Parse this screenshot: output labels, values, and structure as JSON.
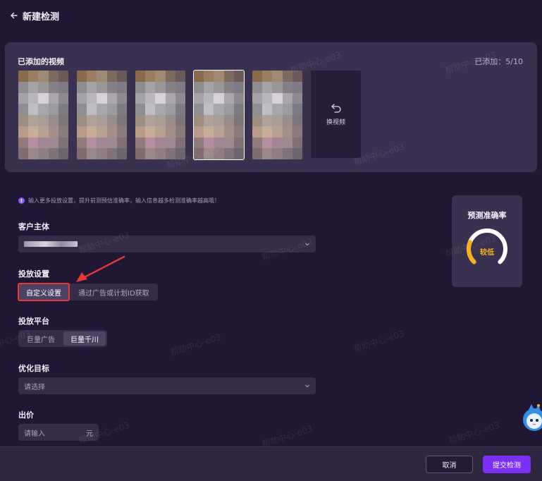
{
  "header": {
    "title": "新建检测"
  },
  "videos": {
    "title": "已添加的视频",
    "count_label": "已添加：5/10",
    "swap_label": "换视频",
    "thumbnails": [
      {
        "palette": [
          "#8a6a4e",
          "#9b7e62",
          "#a08a74",
          "#7d6a60",
          "#6a5a5a",
          "#8f8c90",
          "#a5a3a8",
          "#9a9698",
          "#857f86",
          "#7f7a86",
          "#a6a3a8",
          "#b8b6bb",
          "#d4d2d6",
          "#a9a7ab",
          "#8d8a90",
          "#8f8e94",
          "#bfbec4",
          "#a7a6ab",
          "#9d9ba0",
          "#7d7b84",
          "#9c8f82",
          "#b0a29a",
          "#a69d96",
          "#988d8a",
          "#7e7578",
          "#b89a88",
          "#c6ad98",
          "#b7a192",
          "#a28f88",
          "#8a7b7c",
          "#8f7a7c",
          "#b48da0",
          "#a38596",
          "#9c8a90",
          "#7f7076",
          "#7e6c70",
          "#9b888a",
          "#8f7f82",
          "#80727a",
          "#6e646c"
        ]
      },
      {
        "palette": [
          "#8a6a4e",
          "#9b7e62",
          "#a08a74",
          "#7d6a60",
          "#6a5a5a",
          "#8f8c90",
          "#a5a3a8",
          "#9a9698",
          "#857f86",
          "#7f7a86",
          "#a6a3a8",
          "#b8b6bb",
          "#d4d2d6",
          "#a9a7ab",
          "#8d8a90",
          "#8f8e94",
          "#bfbec4",
          "#a7a6ab",
          "#9d9ba0",
          "#7d7b84",
          "#9c8f82",
          "#b0a29a",
          "#a69d96",
          "#988d8a",
          "#7e7578",
          "#b89a88",
          "#c6ad98",
          "#b7a192",
          "#a28f88",
          "#8a7b7c",
          "#8f7a7c",
          "#b48da0",
          "#a38596",
          "#9c8a90",
          "#7f7076",
          "#7e6c70",
          "#9b888a",
          "#8f7f82",
          "#80727a",
          "#6e646c"
        ]
      },
      {
        "palette": [
          "#8a6a4e",
          "#9b7e62",
          "#a08a74",
          "#7d6a60",
          "#6a5a5a",
          "#8f8c90",
          "#a5a3a8",
          "#9a9698",
          "#857f86",
          "#7f7a86",
          "#a6a3a8",
          "#b8b6bb",
          "#d4d2d6",
          "#a9a7ab",
          "#8d8a90",
          "#8f8e94",
          "#bfbec4",
          "#a7a6ab",
          "#9d9ba0",
          "#7d7b84",
          "#9c8f82",
          "#b0a29a",
          "#a69d96",
          "#988d8a",
          "#7e7578",
          "#b89a88",
          "#c6ad98",
          "#b7a192",
          "#a28f88",
          "#8a7b7c",
          "#8f7a7c",
          "#b48da0",
          "#a38596",
          "#9c8a90",
          "#7f7076",
          "#7e6c70",
          "#9b888a",
          "#8f7f82",
          "#80727a",
          "#6e646c"
        ]
      },
      {
        "palette": [
          "#8a6a4e",
          "#9b7e62",
          "#a08a74",
          "#7d6a60",
          "#6a5a5a",
          "#8f8c90",
          "#a5a3a8",
          "#9a9698",
          "#857f86",
          "#7f7a86",
          "#a6a3a8",
          "#b8b6bb",
          "#d4d2d6",
          "#a9a7ab",
          "#8d8a90",
          "#8f8e94",
          "#bfbec4",
          "#a7a6ab",
          "#9d9ba0",
          "#7d7b84",
          "#9c8f82",
          "#b0a29a",
          "#a69d96",
          "#988d8a",
          "#7e7578",
          "#b89a88",
          "#c6ad98",
          "#b7a192",
          "#a28f88",
          "#8a7b7c",
          "#8f7a7c",
          "#b48da0",
          "#a38596",
          "#9c8a90",
          "#7f7076",
          "#7e6c70",
          "#9b888a",
          "#8f7f82",
          "#80727a",
          "#6e646c"
        ]
      },
      {
        "palette": [
          "#8a6a4e",
          "#9b7e62",
          "#a08a74",
          "#7d6a60",
          "#6a5a5a",
          "#8f8c90",
          "#a5a3a8",
          "#9a9698",
          "#857f86",
          "#7f7a86",
          "#a6a3a8",
          "#b8b6bb",
          "#d4d2d6",
          "#a9a7ab",
          "#8d8a90",
          "#8f8e94",
          "#bfbec4",
          "#a7a6ab",
          "#9d9ba0",
          "#7d7b84",
          "#9c8f82",
          "#b0a29a",
          "#a69d96",
          "#988d8a",
          "#7e7578",
          "#b89a88",
          "#c6ad98",
          "#b7a192",
          "#a28f88",
          "#8a7b7c",
          "#8f7a7c",
          "#b48da0",
          "#a38596",
          "#9c8a90",
          "#7f7076",
          "#7e6c70",
          "#9b888a",
          "#8f7f82",
          "#80727a",
          "#6e646c"
        ]
      }
    ]
  },
  "hint": {
    "icon": "!",
    "text": "输入更多投放设置，提升前测预估准确率，输入信息越多检测准确率越高哦！"
  },
  "customer": {
    "label": "客户主体"
  },
  "delivery": {
    "label": "投放设置",
    "options": [
      "自定义设置",
      "通过广告或计划ID获取"
    ]
  },
  "platform": {
    "label": "投放平台",
    "options": [
      "巨量广告",
      "巨量千川"
    ]
  },
  "goal": {
    "label": "优化目标",
    "placeholder": "请选择"
  },
  "bid": {
    "label": "出价",
    "placeholder": "请输入",
    "unit": "元"
  },
  "accuracy": {
    "title": "预测准确率",
    "level": "较低",
    "gauge_fraction": 0.25,
    "accent": "#f5b020"
  },
  "footer": {
    "cancel": "取消",
    "submit": "提交检测"
  },
  "watermark": {
    "text": "帮助中心-e03"
  }
}
